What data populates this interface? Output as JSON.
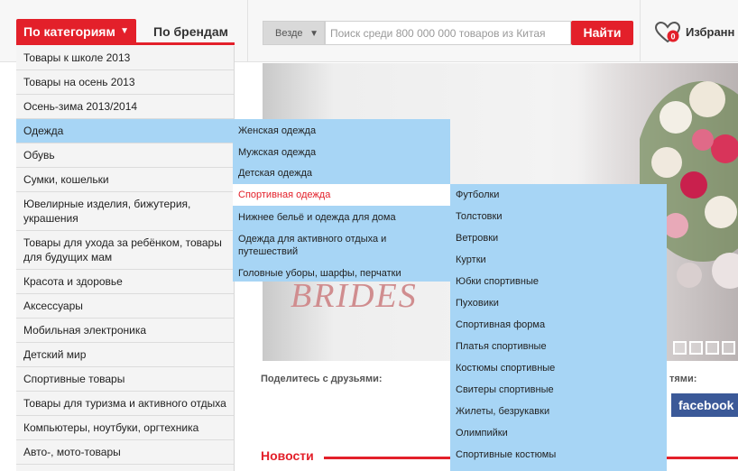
{
  "header": {
    "categories_tab": "По категориям",
    "brands_tab": "По брендам",
    "search_scope": "Везде",
    "search_placeholder": "Поиск среди 800 000 000 товаров из Китая",
    "search_button": "Найти",
    "favorites_label": "Избранн",
    "favorites_count": "0"
  },
  "menu": {
    "items": [
      "Товары к школе 2013",
      "Товары на осень 2013",
      "Осень-зима 2013/2014",
      "Одежда",
      "Обувь",
      "Сумки, кошельки",
      "Ювелирные изделия, бижутерия, украшения",
      "Товары для ухода за ребёнком, товары для будущих мам",
      "Красота и здоровье",
      "Аксессуары",
      "Мобильная электроника",
      "Детский мир",
      "Спортивные товары",
      "Товары для туризма и активного отдыха",
      "Компьютеры, ноутбуки, оргтехника",
      "Авто-, мото-товары"
    ],
    "active_index": 3
  },
  "submenu_clothing": {
    "items": [
      "Женская одежда",
      "Мужская одежда",
      "Детская одежда",
      "Спортивная одежда",
      "Нижнее бельё и одежда для дома",
      "Одежда для активного отдыха и путешествий",
      "Головные уборы, шарфы, перчатки"
    ],
    "selected_index": 3
  },
  "submenu_sport": {
    "items": [
      "Футболки",
      "Толстовки",
      "Ветровки",
      "Куртки",
      "Юбки спортивные",
      "Пуховики",
      "Спортивная форма",
      "Платья спортивные",
      "Костюмы спортивные",
      "Свитеры спортивные",
      "Жилеты, безрукавки",
      "Олимпийки",
      "Спортивные костюмы"
    ]
  },
  "banner": {
    "text": "BRIDES"
  },
  "share": {
    "label": "Поделитесь с друзьями:",
    "label_right": "тями:",
    "facebook": "facebook"
  },
  "news": {
    "title": "Новости"
  },
  "colors": {
    "accent": "#e3202a",
    "menu_highlight": "#a7d5f5",
    "facebook": "#3b5998"
  },
  "icons": {
    "favorites": "heart-icon",
    "dropdown": "triangle-down-icon"
  }
}
